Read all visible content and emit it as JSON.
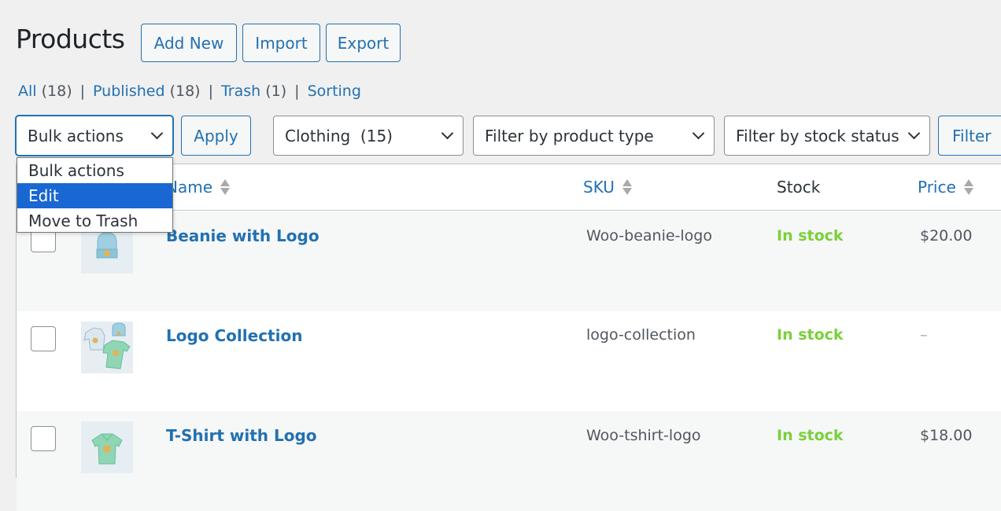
{
  "header": {
    "title": "Products",
    "buttons": {
      "add_new": "Add New",
      "import": "Import",
      "export": "Export"
    }
  },
  "views": [
    {
      "label": "All",
      "count": "(18)"
    },
    {
      "label": "Published",
      "count": "(18)"
    },
    {
      "label": "Trash",
      "count": "(1)"
    },
    {
      "label": "Sorting",
      "count": ""
    }
  ],
  "separator": "|",
  "filters": {
    "bulk_actions": {
      "value": "Bulk actions",
      "options": [
        "Bulk actions",
        "Edit",
        "Move to Trash"
      ],
      "highlighted": "Edit"
    },
    "apply_label": "Apply",
    "category": "Clothing  (15)",
    "product_type": "Filter by product type",
    "stock_status": "Filter by stock status",
    "filter_label": "Filter"
  },
  "table": {
    "columns": {
      "name": "Name",
      "sku": "SKU",
      "stock": "Stock",
      "price": "Price"
    },
    "rows": [
      {
        "name": "Beanie with Logo",
        "sku": "Woo-beanie-logo",
        "stock": "In stock",
        "price": "$20.00",
        "thumb": "beanie"
      },
      {
        "name": "Logo Collection",
        "sku": "logo-collection",
        "stock": "In stock",
        "price": "–",
        "thumb": "collection"
      },
      {
        "name": "T-Shirt with Logo",
        "sku": "Woo-tshirt-logo",
        "stock": "In stock",
        "price": "$18.00",
        "thumb": "tshirt"
      }
    ]
  },
  "colors": {
    "link": "#2271b1",
    "in_stock": "#7ad03a",
    "selected_option": "#1967d2",
    "background": "#f0f0f1"
  }
}
